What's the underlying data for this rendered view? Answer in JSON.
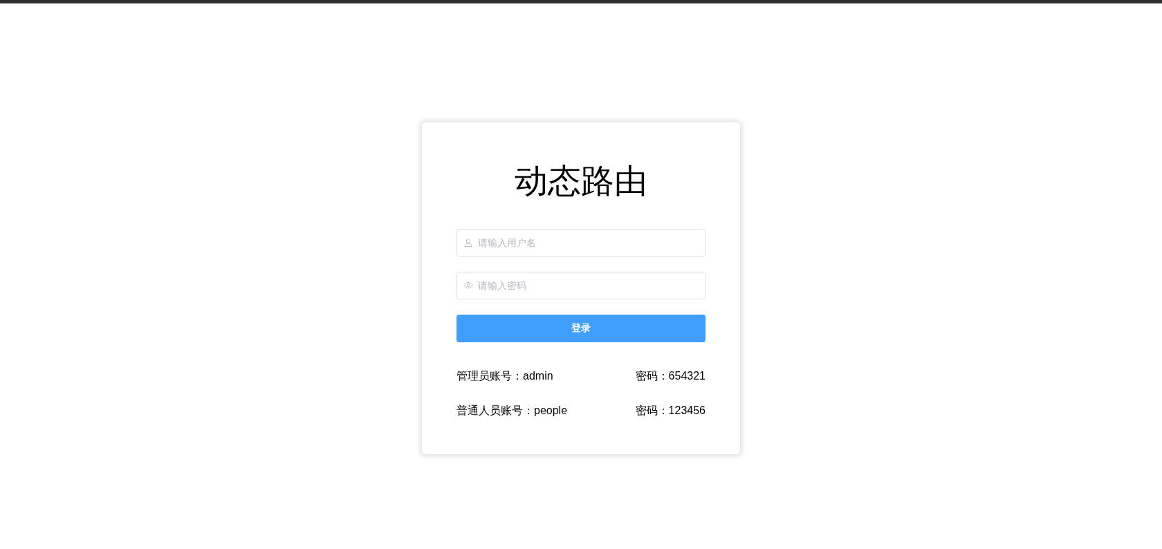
{
  "title": "动态路由",
  "form": {
    "fields": [
      {
        "kind": "user",
        "placeholder": "请输入用户名"
      },
      {
        "kind": "password",
        "placeholder": "请输入密码"
      }
    ],
    "submit": "登录"
  },
  "accounts": [
    {
      "account": "管理员账号：admin",
      "password": "密码：654321"
    },
    {
      "account": "普通人员账号：people",
      "password": "密码：123456"
    }
  ]
}
